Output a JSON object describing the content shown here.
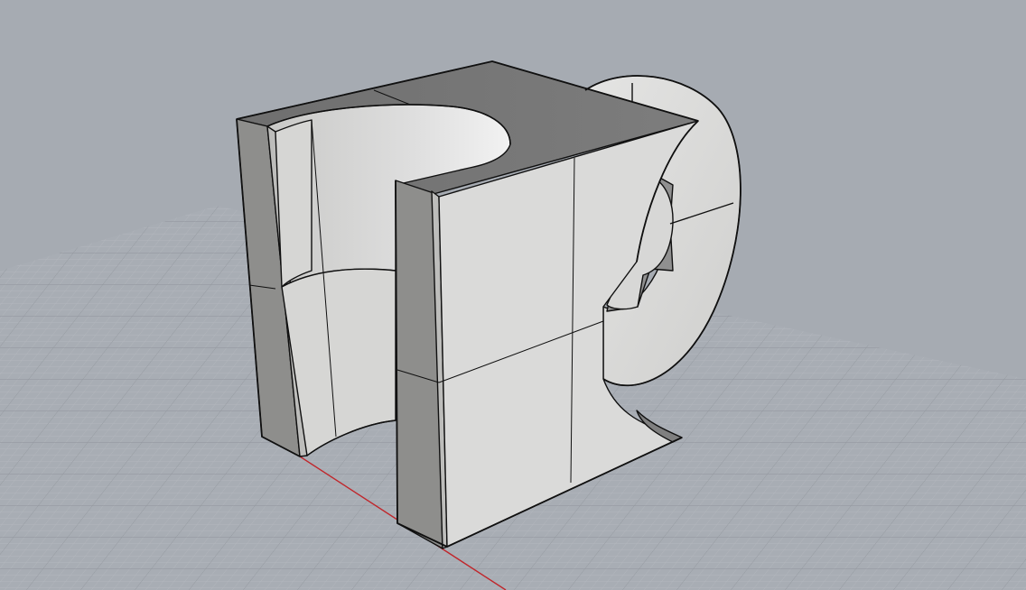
{
  "viewport": {
    "background": "#a6abb2",
    "grid_minor_color": "#b3b7bd",
    "grid_major_color": "#8f949b",
    "x_axis_color": "#c0262b",
    "model_light": "#dcdcdb",
    "model_mid": "#cfcfcd",
    "model_dark": "#8d8d8b",
    "model_top": "#7a7a7a",
    "edge_color": "#101010"
  }
}
